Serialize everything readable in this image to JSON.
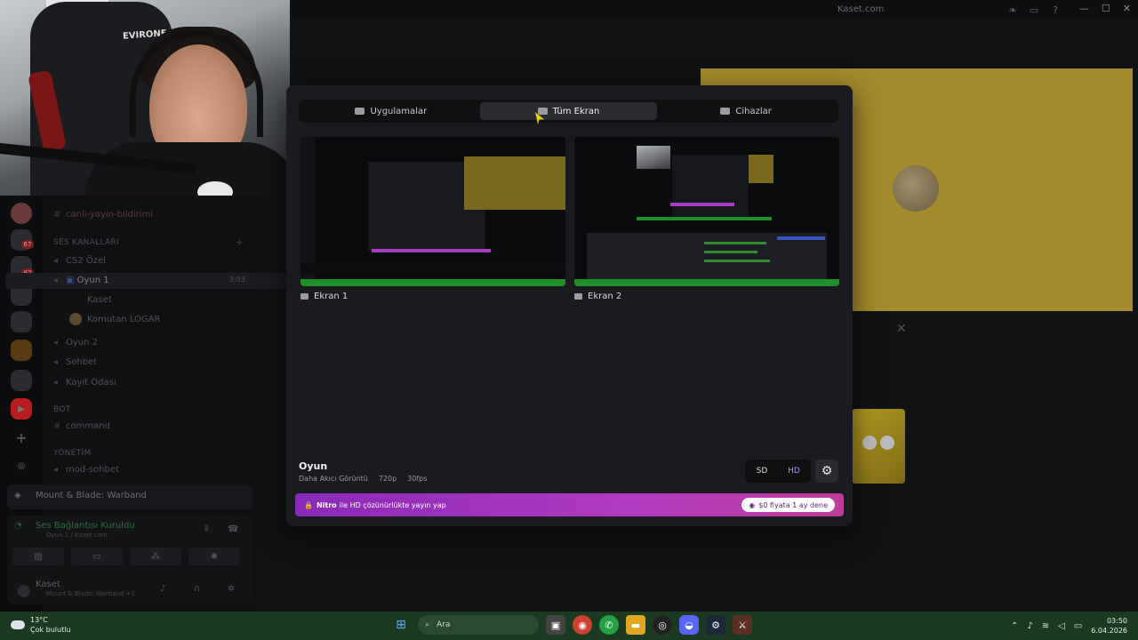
{
  "window": {
    "title": "Kaset.com",
    "controls": [
      "—",
      "☐",
      "✕"
    ]
  },
  "webcam": {
    "chair_brand": "EVIRONE"
  },
  "sidebar": {
    "channels": [
      {
        "label": "canli-yayin-bildirimi",
        "type": "text"
      }
    ],
    "voice_category": "SES KANALLARI",
    "voice_channels": [
      "CS2 Özel",
      "Oyun 1",
      "Oyun 2",
      "Sohbet",
      "Kayıt Odası"
    ],
    "active_timer": "3:03",
    "users": [
      "Kaset",
      "Komutan LOGAR"
    ],
    "bot_category": "BOT",
    "bot_channels": [
      "command"
    ],
    "admin_category": "YÖNETİM",
    "admin_channels": [
      "mod-sohbet"
    ],
    "badges": [
      "67",
      "82"
    ],
    "game_activity": "Mount & Blade: Warband",
    "voice_status": "Ses Bağlantısı Kuruldu",
    "voice_location": "Oyun 1 / Kaset.com",
    "user_name": "Kaset",
    "user_status": "Mount & Blade: Warband +1"
  },
  "modal": {
    "tabs": [
      {
        "label": "Uygulamalar",
        "icon": "window-icon",
        "active": false
      },
      {
        "label": "Tüm Ekran",
        "icon": "monitor-icon",
        "active": true
      },
      {
        "label": "Cihazlar",
        "icon": "camera-icon",
        "active": false
      }
    ],
    "screens": [
      {
        "label": "Ekran 1"
      },
      {
        "label": "Ekran 2"
      }
    ],
    "stream": {
      "title": "Oyun",
      "mode": "Daha Akıcı Görüntü",
      "resolution": "720p",
      "fps": "30fps"
    },
    "quality": {
      "sd": "SD",
      "hd": "HD",
      "selected": "HD"
    },
    "nitro": {
      "brand": "Nitro",
      "text": "ile HD çözünürlükte yayın yap",
      "cta": "$0 fiyata 1 ay dene"
    }
  },
  "taskbar": {
    "weather_temp": "13°C",
    "weather_desc": "Çok bulutlu",
    "search_placeholder": "Ara",
    "time": "03:50",
    "date": "6.04.2026"
  },
  "colors": {
    "accent": "#b03ac0",
    "taskbar": "#1a3a22",
    "green": "#1f8f2a"
  }
}
